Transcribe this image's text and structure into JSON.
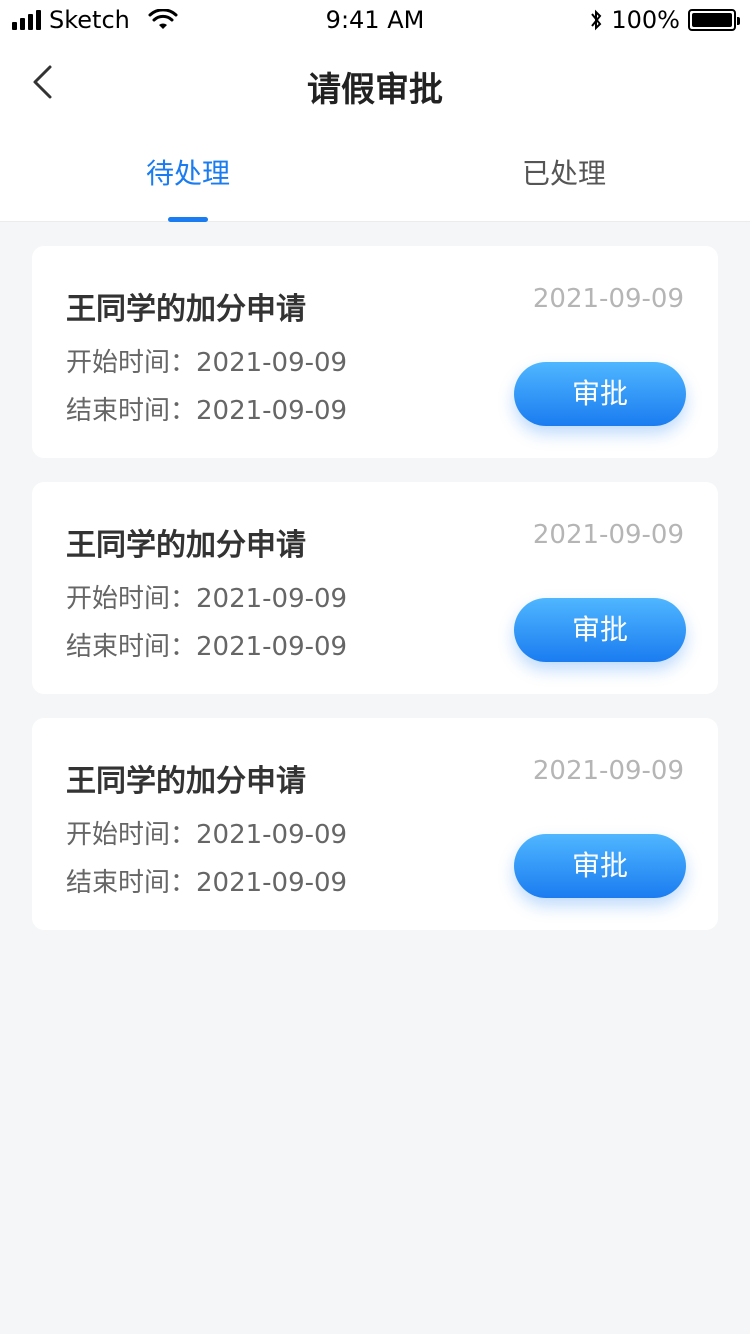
{
  "status_bar": {
    "carrier": "Sketch",
    "time": "9:41 AM",
    "battery": "100%",
    "icons": [
      "signal-icon",
      "wifi-icon",
      "bluetooth-icon",
      "battery-icon"
    ]
  },
  "header": {
    "title": "请假审批",
    "back_icon": "chevron-left-icon"
  },
  "tabs": [
    {
      "label": "待处理",
      "active": true
    },
    {
      "label": "已处理",
      "active": false
    }
  ],
  "cards": [
    {
      "title": "王同学的加分申请",
      "date": "2021-09-09",
      "start": "开始时间：2021-09-09",
      "end": "结束时间：2021-09-09",
      "button": "审批"
    },
    {
      "title": "王同学的加分申请",
      "date": "2021-09-09",
      "start": "开始时间：2021-09-09",
      "end": "结束时间：2021-09-09",
      "button": "审批"
    },
    {
      "title": "王同学的加分申请",
      "date": "2021-09-09",
      "start": "开始时间：2021-09-09",
      "end": "结束时间：2021-09-09",
      "button": "审批"
    }
  ],
  "colors": {
    "accent": "#1a7cf0",
    "background": "#f5f6f8"
  }
}
